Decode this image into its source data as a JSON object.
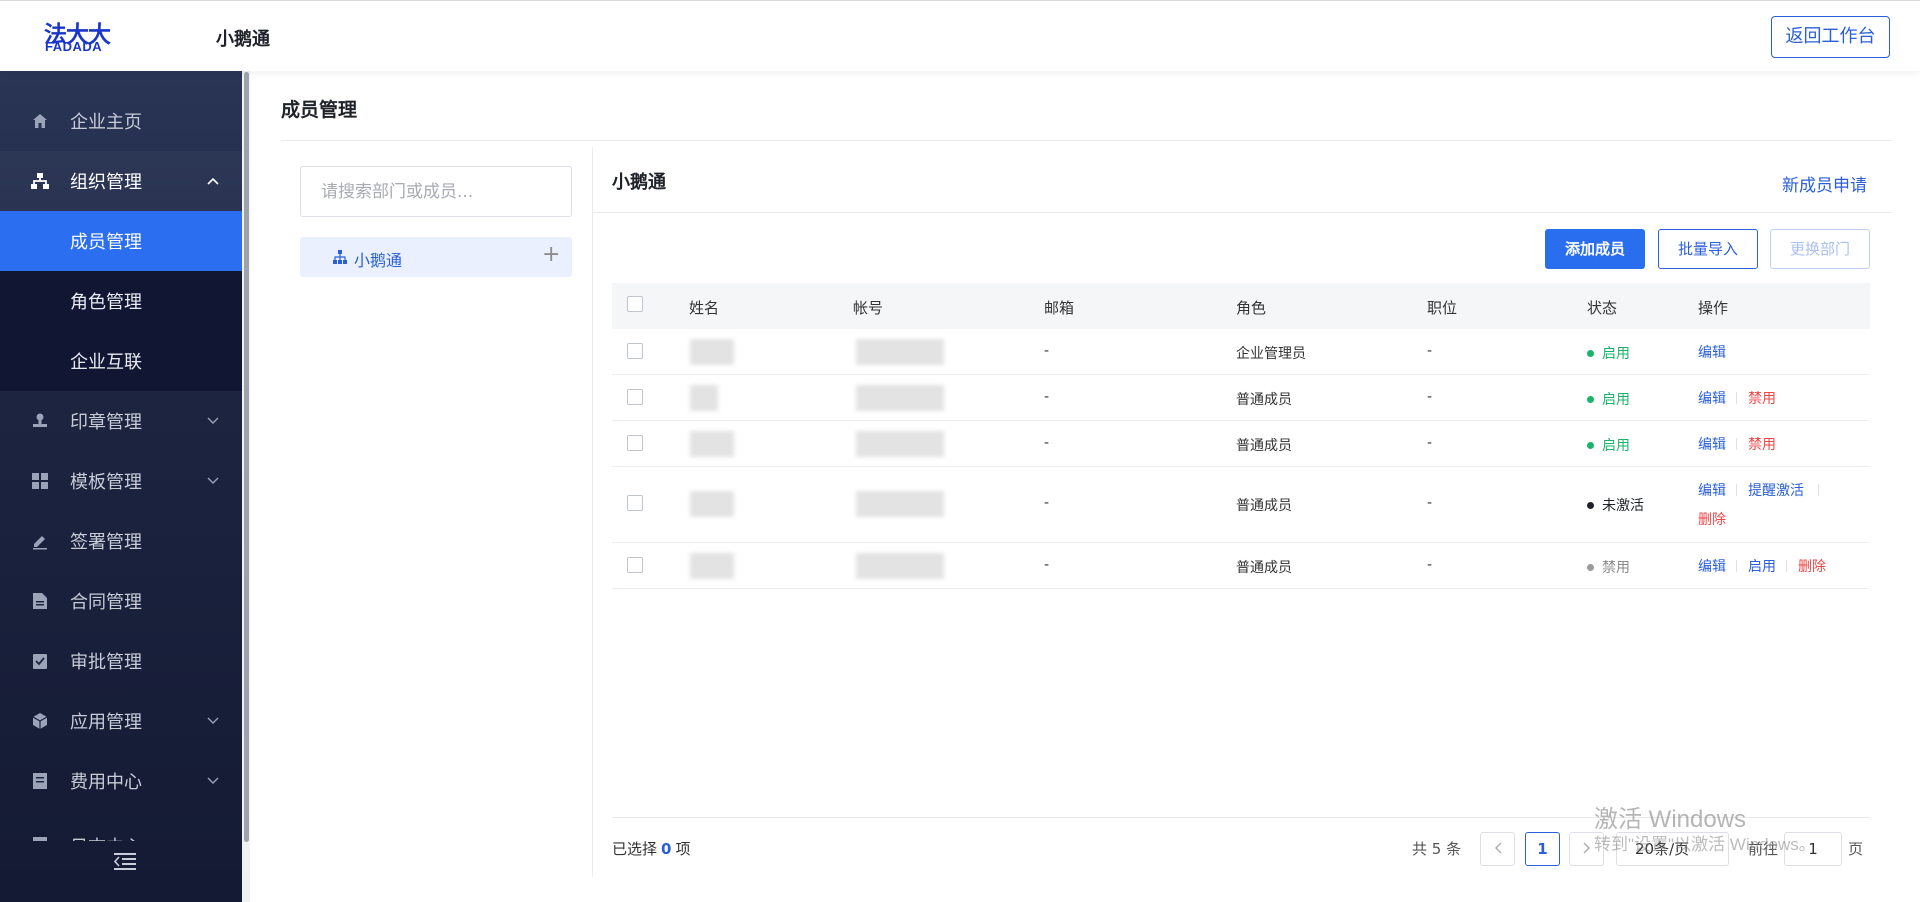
{
  "header": {
    "logo_cn": "法大大",
    "logo_en": "FADADA",
    "company": "小鹅通",
    "back_button": "返回工作台"
  },
  "sidebar": {
    "items": [
      {
        "label": "企业主页",
        "icon": "home-icon"
      },
      {
        "label": "组织管理",
        "icon": "org-icon",
        "expanded": true
      },
      {
        "label": "成员管理",
        "sub": true,
        "active": true
      },
      {
        "label": "角色管理",
        "sub": true
      },
      {
        "label": "企业互联",
        "sub": true
      },
      {
        "label": "印章管理",
        "icon": "seal-icon"
      },
      {
        "label": "模板管理",
        "icon": "template-icon"
      },
      {
        "label": "签署管理",
        "icon": "sign-icon"
      },
      {
        "label": "合同管理",
        "icon": "contract-icon"
      },
      {
        "label": "审批管理",
        "icon": "approval-icon"
      },
      {
        "label": "应用管理",
        "icon": "app-icon"
      },
      {
        "label": "费用中心",
        "icon": "fee-icon"
      },
      {
        "label": "日志中心",
        "icon": "log-icon"
      }
    ]
  },
  "page": {
    "title": "成员管理"
  },
  "tree": {
    "search_placeholder": "请搜索部门或成员...",
    "root_node": "小鹅通"
  },
  "dept": {
    "title": "小鹅通",
    "new_apply": "新成员申请",
    "buttons": {
      "add": "添加成员",
      "import": "批量导入",
      "change_dept": "更换部门"
    }
  },
  "table": {
    "columns": [
      "姓名",
      "帐号",
      "邮箱",
      "角色",
      "职位",
      "状态",
      "操作"
    ],
    "rows": [
      {
        "email": "-",
        "role": "企业管理员",
        "position": "-",
        "status": "启用",
        "status_color": "#19b46a",
        "ops": [
          "编辑"
        ]
      },
      {
        "email": "-",
        "role": "普通成员",
        "position": "-",
        "status": "启用",
        "status_color": "#19b46a",
        "ops": [
          "编辑",
          "禁用"
        ]
      },
      {
        "email": "-",
        "role": "普通成员",
        "position": "-",
        "status": "启用",
        "status_color": "#19b46a",
        "ops": [
          "编辑",
          "禁用"
        ]
      },
      {
        "email": "-",
        "role": "普通成员",
        "position": "-",
        "status": "未激活",
        "status_color": "#1f2329",
        "ops": [
          "编辑",
          "提醒激活",
          "删除"
        ]
      },
      {
        "email": "-",
        "role": "普通成员",
        "position": "-",
        "status": "禁用",
        "status_color": "#9a9a9a",
        "ops": [
          "编辑",
          "启用",
          "删除"
        ]
      }
    ]
  },
  "footer": {
    "selected_prefix": "已选择",
    "selected_count": "0",
    "selected_suffix": "项",
    "total": "共 5 条",
    "current_page": "1",
    "page_size": "20条/页",
    "goto_label": "前往",
    "goto_value": "1",
    "goto_unit": "页"
  },
  "watermark": {
    "line1": "激活 Windows",
    "line2": "转到\"设置\"以激活 Windows。"
  },
  "colors": {
    "primary": "#2a6ef0",
    "danger": "#f04545",
    "success": "#19b46a"
  }
}
